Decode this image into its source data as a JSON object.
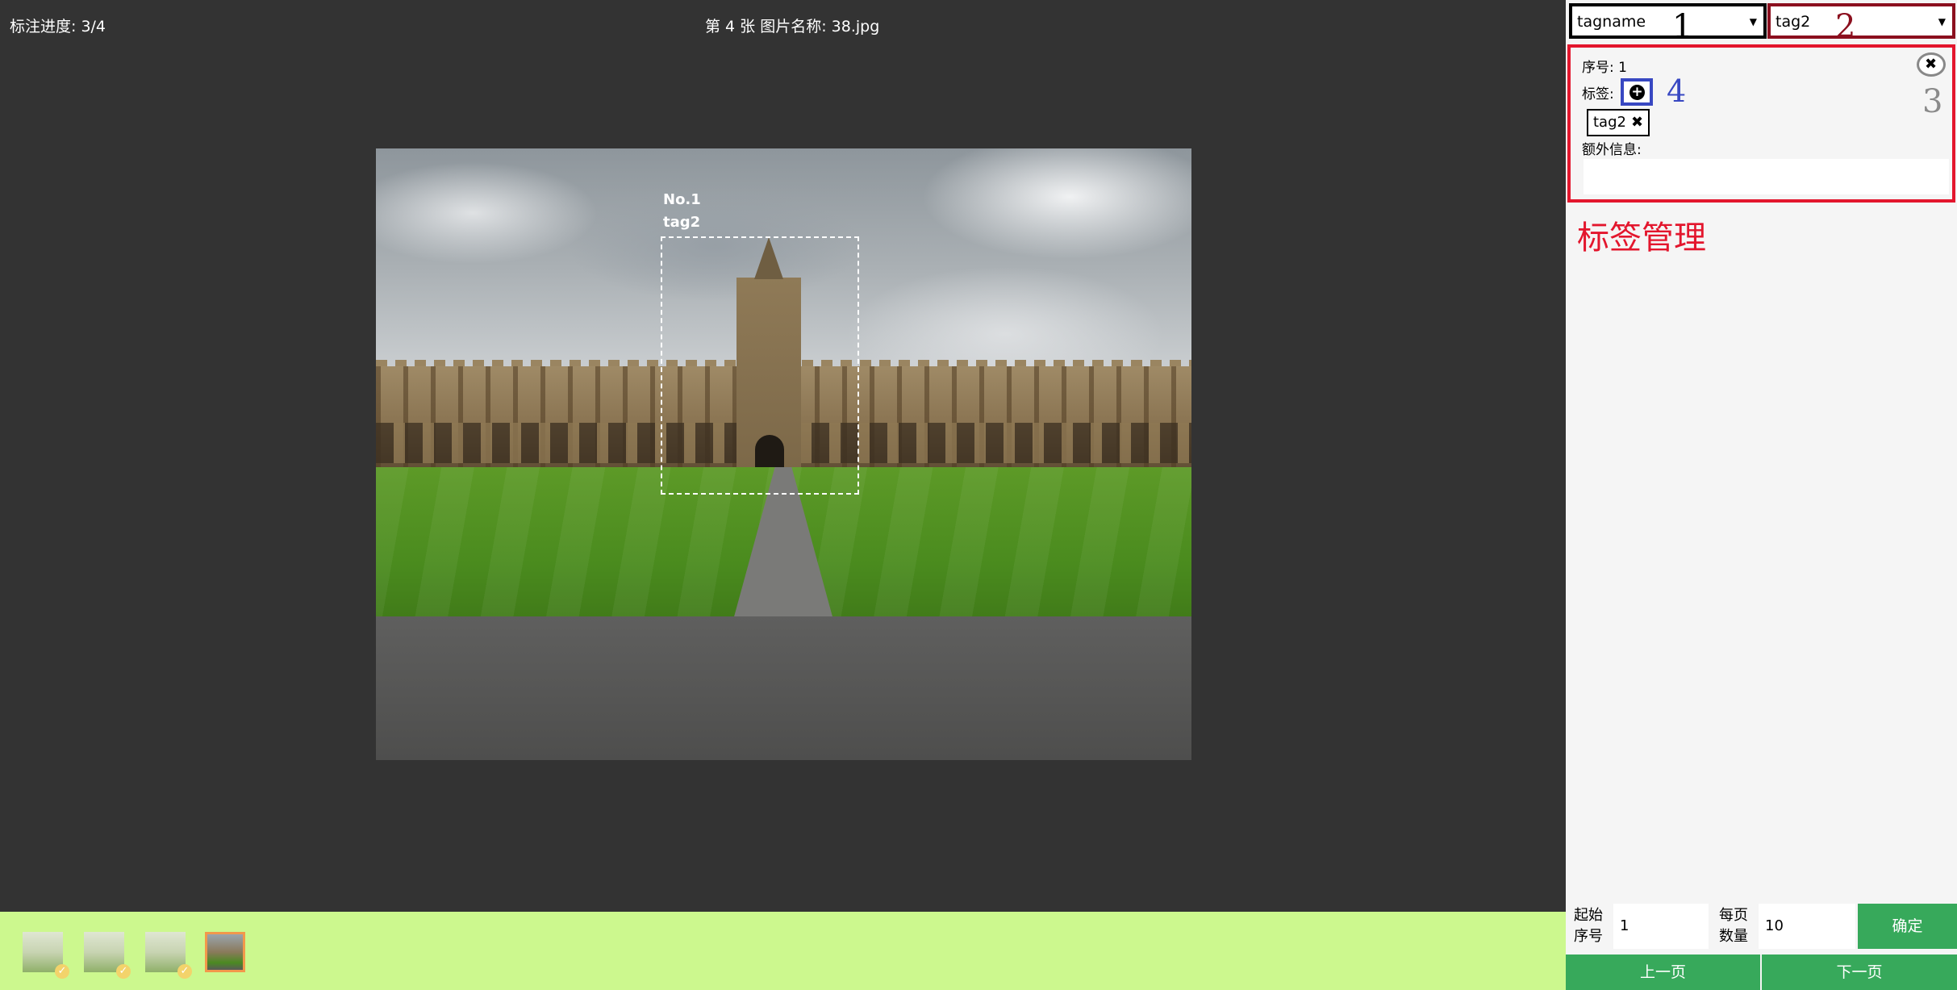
{
  "top": {
    "progress": "标注进度: 3/4",
    "image_title": "第 4 张 图片名称: 38.jpg"
  },
  "annotation": {
    "number": "No.1",
    "tag": "tag2"
  },
  "thumbnails": [
    {
      "done": true,
      "active": false
    },
    {
      "done": true,
      "active": false
    },
    {
      "done": true,
      "active": false
    },
    {
      "done": false,
      "active": true
    }
  ],
  "panel": {
    "select1": {
      "value": "tagname",
      "callout": "1"
    },
    "select2": {
      "value": "tag2",
      "callout": "2"
    },
    "index_label": "序号: 1",
    "tag_label": "标签:",
    "add_callout": "4",
    "close_callout": "3",
    "tag_chip": "tag2",
    "extra_label": "额外信息:",
    "extra_value": "",
    "management_title": "标签管理"
  },
  "pager": {
    "start_label_1": "起始",
    "start_label_2": "序号",
    "start_value": "1",
    "per_page_label_1": "每页",
    "per_page_label_2": "数量",
    "per_page_value": "10",
    "confirm": "确定",
    "prev": "上一页",
    "next": "下一页"
  },
  "colors": {
    "background": "#333333",
    "thumb_bar": "#ccf88e",
    "green_button": "#37a95b",
    "red_border": "#e3162d",
    "dark_red_border": "#8b0f1e",
    "blue_border": "#3848c2"
  }
}
